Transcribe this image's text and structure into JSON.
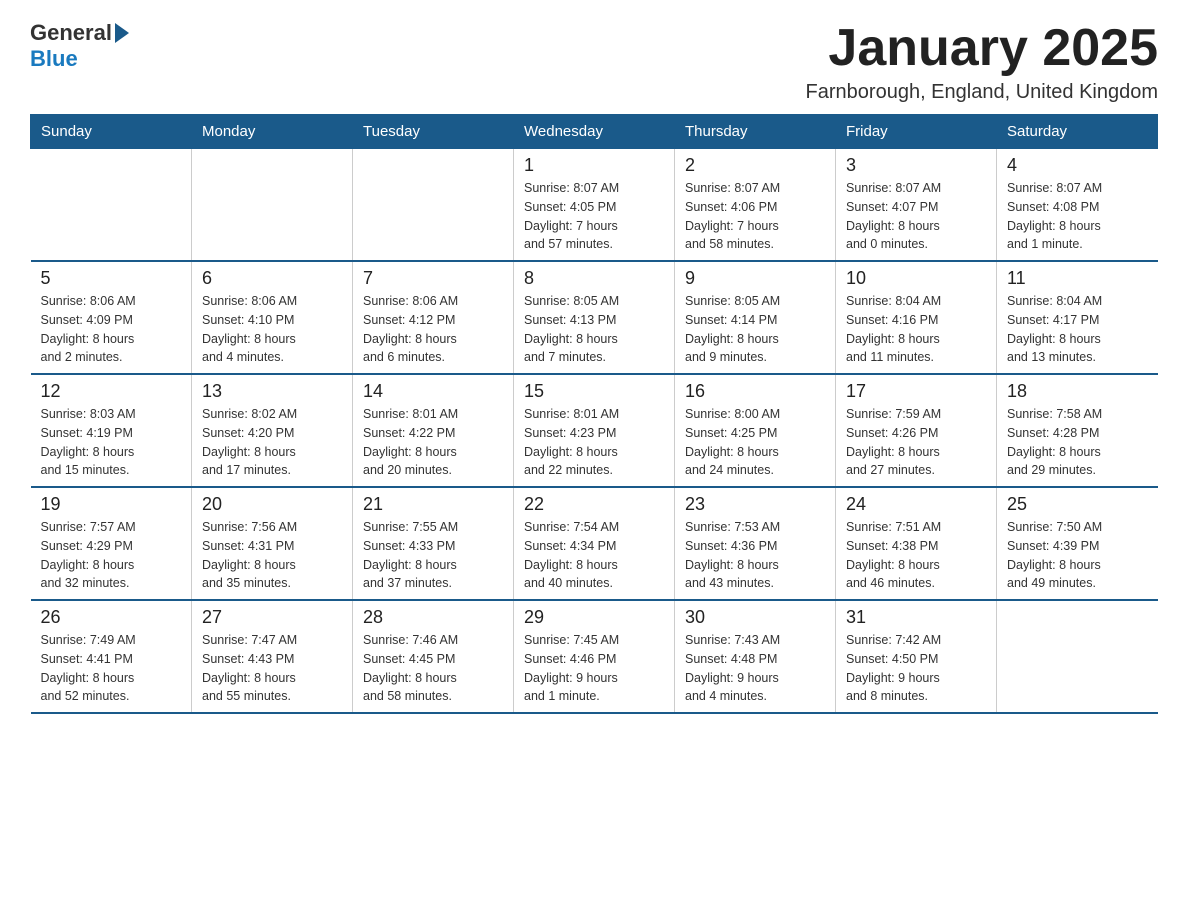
{
  "logo": {
    "general": "General",
    "blue": "Blue"
  },
  "title": "January 2025",
  "subtitle": "Farnborough, England, United Kingdom",
  "days_of_week": [
    "Sunday",
    "Monday",
    "Tuesday",
    "Wednesday",
    "Thursday",
    "Friday",
    "Saturday"
  ],
  "weeks": [
    [
      {
        "day": "",
        "info": ""
      },
      {
        "day": "",
        "info": ""
      },
      {
        "day": "",
        "info": ""
      },
      {
        "day": "1",
        "info": "Sunrise: 8:07 AM\nSunset: 4:05 PM\nDaylight: 7 hours\nand 57 minutes."
      },
      {
        "day": "2",
        "info": "Sunrise: 8:07 AM\nSunset: 4:06 PM\nDaylight: 7 hours\nand 58 minutes."
      },
      {
        "day": "3",
        "info": "Sunrise: 8:07 AM\nSunset: 4:07 PM\nDaylight: 8 hours\nand 0 minutes."
      },
      {
        "day": "4",
        "info": "Sunrise: 8:07 AM\nSunset: 4:08 PM\nDaylight: 8 hours\nand 1 minute."
      }
    ],
    [
      {
        "day": "5",
        "info": "Sunrise: 8:06 AM\nSunset: 4:09 PM\nDaylight: 8 hours\nand 2 minutes."
      },
      {
        "day": "6",
        "info": "Sunrise: 8:06 AM\nSunset: 4:10 PM\nDaylight: 8 hours\nand 4 minutes."
      },
      {
        "day": "7",
        "info": "Sunrise: 8:06 AM\nSunset: 4:12 PM\nDaylight: 8 hours\nand 6 minutes."
      },
      {
        "day": "8",
        "info": "Sunrise: 8:05 AM\nSunset: 4:13 PM\nDaylight: 8 hours\nand 7 minutes."
      },
      {
        "day": "9",
        "info": "Sunrise: 8:05 AM\nSunset: 4:14 PM\nDaylight: 8 hours\nand 9 minutes."
      },
      {
        "day": "10",
        "info": "Sunrise: 8:04 AM\nSunset: 4:16 PM\nDaylight: 8 hours\nand 11 minutes."
      },
      {
        "day": "11",
        "info": "Sunrise: 8:04 AM\nSunset: 4:17 PM\nDaylight: 8 hours\nand 13 minutes."
      }
    ],
    [
      {
        "day": "12",
        "info": "Sunrise: 8:03 AM\nSunset: 4:19 PM\nDaylight: 8 hours\nand 15 minutes."
      },
      {
        "day": "13",
        "info": "Sunrise: 8:02 AM\nSunset: 4:20 PM\nDaylight: 8 hours\nand 17 minutes."
      },
      {
        "day": "14",
        "info": "Sunrise: 8:01 AM\nSunset: 4:22 PM\nDaylight: 8 hours\nand 20 minutes."
      },
      {
        "day": "15",
        "info": "Sunrise: 8:01 AM\nSunset: 4:23 PM\nDaylight: 8 hours\nand 22 minutes."
      },
      {
        "day": "16",
        "info": "Sunrise: 8:00 AM\nSunset: 4:25 PM\nDaylight: 8 hours\nand 24 minutes."
      },
      {
        "day": "17",
        "info": "Sunrise: 7:59 AM\nSunset: 4:26 PM\nDaylight: 8 hours\nand 27 minutes."
      },
      {
        "day": "18",
        "info": "Sunrise: 7:58 AM\nSunset: 4:28 PM\nDaylight: 8 hours\nand 29 minutes."
      }
    ],
    [
      {
        "day": "19",
        "info": "Sunrise: 7:57 AM\nSunset: 4:29 PM\nDaylight: 8 hours\nand 32 minutes."
      },
      {
        "day": "20",
        "info": "Sunrise: 7:56 AM\nSunset: 4:31 PM\nDaylight: 8 hours\nand 35 minutes."
      },
      {
        "day": "21",
        "info": "Sunrise: 7:55 AM\nSunset: 4:33 PM\nDaylight: 8 hours\nand 37 minutes."
      },
      {
        "day": "22",
        "info": "Sunrise: 7:54 AM\nSunset: 4:34 PM\nDaylight: 8 hours\nand 40 minutes."
      },
      {
        "day": "23",
        "info": "Sunrise: 7:53 AM\nSunset: 4:36 PM\nDaylight: 8 hours\nand 43 minutes."
      },
      {
        "day": "24",
        "info": "Sunrise: 7:51 AM\nSunset: 4:38 PM\nDaylight: 8 hours\nand 46 minutes."
      },
      {
        "day": "25",
        "info": "Sunrise: 7:50 AM\nSunset: 4:39 PM\nDaylight: 8 hours\nand 49 minutes."
      }
    ],
    [
      {
        "day": "26",
        "info": "Sunrise: 7:49 AM\nSunset: 4:41 PM\nDaylight: 8 hours\nand 52 minutes."
      },
      {
        "day": "27",
        "info": "Sunrise: 7:47 AM\nSunset: 4:43 PM\nDaylight: 8 hours\nand 55 minutes."
      },
      {
        "day": "28",
        "info": "Sunrise: 7:46 AM\nSunset: 4:45 PM\nDaylight: 8 hours\nand 58 minutes."
      },
      {
        "day": "29",
        "info": "Sunrise: 7:45 AM\nSunset: 4:46 PM\nDaylight: 9 hours\nand 1 minute."
      },
      {
        "day": "30",
        "info": "Sunrise: 7:43 AM\nSunset: 4:48 PM\nDaylight: 9 hours\nand 4 minutes."
      },
      {
        "day": "31",
        "info": "Sunrise: 7:42 AM\nSunset: 4:50 PM\nDaylight: 9 hours\nand 8 minutes."
      },
      {
        "day": "",
        "info": ""
      }
    ]
  ]
}
